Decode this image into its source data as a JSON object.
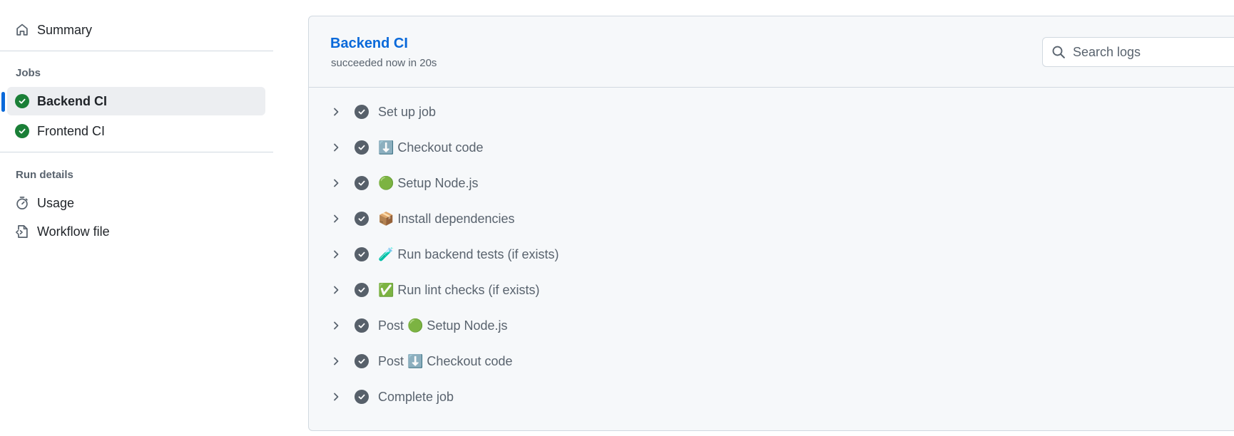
{
  "sidebar": {
    "summary_label": "Summary",
    "jobs_heading": "Jobs",
    "jobs": [
      {
        "label": "Backend CI",
        "status": "success"
      },
      {
        "label": "Frontend CI",
        "status": "success"
      }
    ],
    "run_details_heading": "Run details",
    "details": [
      {
        "label": "Usage",
        "icon": "stopwatch-icon"
      },
      {
        "label": "Workflow file",
        "icon": "file-code-icon"
      }
    ]
  },
  "job": {
    "title": "Backend CI",
    "subtitle": "succeeded now in 20s"
  },
  "search": {
    "placeholder": "Search logs"
  },
  "steps": [
    {
      "label": "Set up job"
    },
    {
      "label": "⬇️ Checkout code"
    },
    {
      "label": "🟢 Setup Node.js"
    },
    {
      "label": "📦 Install dependencies"
    },
    {
      "label": "🧪 Run backend tests (if exists)"
    },
    {
      "label": "✅ Run lint checks (if exists)"
    },
    {
      "label": "Post 🟢 Setup Node.js"
    },
    {
      "label": "Post ⬇️ Checkout code"
    },
    {
      "label": "Complete job"
    }
  ],
  "colors": {
    "accent": "#0969da",
    "success": "#1a7f37",
    "step_done": "#57606a"
  }
}
